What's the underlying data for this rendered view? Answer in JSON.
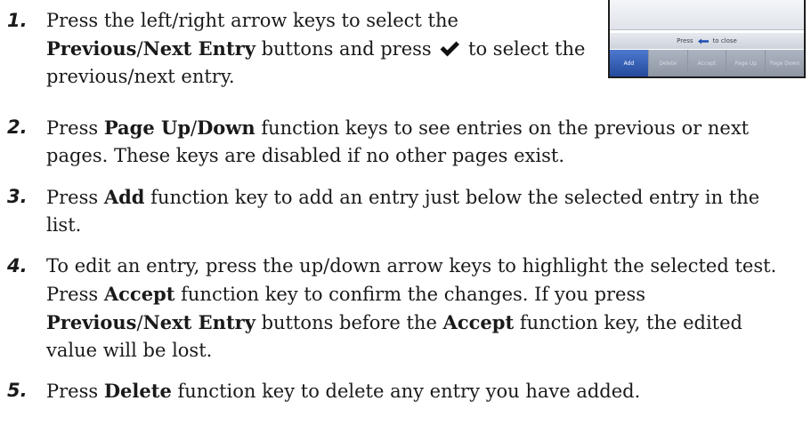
{
  "steps": [
    {
      "num": "1.",
      "parts": [
        {
          "t": "Press the left/right arrow keys to select the "
        },
        {
          "t": "Previous",
          "b": true
        },
        {
          "t": "/"
        },
        {
          "t": "Next Entry",
          "b": true
        },
        {
          "t": " buttons and press "
        },
        {
          "icon": "check-icon"
        },
        {
          "t": " to select the previous/next entry."
        }
      ]
    },
    {
      "num": "2.",
      "parts": [
        {
          "t": "Press "
        },
        {
          "t": "Page Up",
          "b": true
        },
        {
          "t": "/"
        },
        {
          "t": "Down",
          "b": true
        },
        {
          "t": " function keys to see entries on the previous or next pages. These keys are disabled if no other pages exist."
        }
      ]
    },
    {
      "num": "3.",
      "parts": [
        {
          "t": "Press "
        },
        {
          "t": "Add",
          "b": true
        },
        {
          "t": " function key to add an entry just below the selected entry in the list."
        }
      ]
    },
    {
      "num": "4.",
      "parts": [
        {
          "t": "To edit an entry, press the up/down arrow keys to highlight the selected test. Press "
        },
        {
          "t": "Accept",
          "b": true
        },
        {
          "t": " function key to confirm the changes. If you press "
        },
        {
          "t": "Previous",
          "b": true
        },
        {
          "t": "/"
        },
        {
          "t": "Next Entry",
          "b": true
        },
        {
          "t": " buttons before the "
        },
        {
          "t": "Accept",
          "b": true
        },
        {
          "t": " function key, the edited value will be lost."
        }
      ]
    },
    {
      "num": "5.",
      "parts": [
        {
          "t": "Press "
        },
        {
          "t": "Delete",
          "b": true
        },
        {
          "t": " function key to delete any entry you have added."
        }
      ]
    }
  ],
  "device": {
    "hint_before": "Press",
    "hint_after": "to close",
    "keys": [
      "Add",
      "Delete",
      "Accept",
      "Page Up",
      "Page Down"
    ]
  }
}
